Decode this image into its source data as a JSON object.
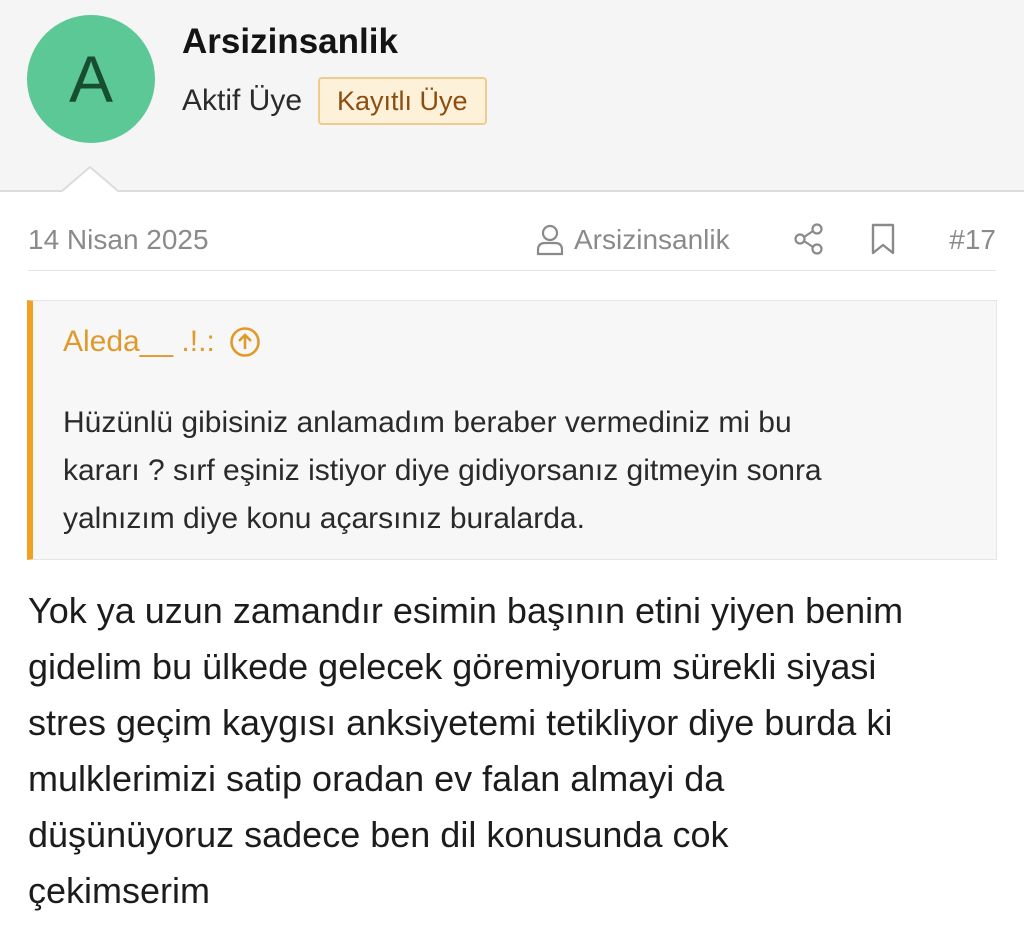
{
  "user": {
    "avatar_letter": "A",
    "avatar_color": "#5cc895",
    "name": "Arsizinsanlik",
    "title": "Aktif Üye",
    "badge": "Kayıtlı Üye"
  },
  "post": {
    "date": "14 Nisan 2025",
    "author": "Arsizinsanlik",
    "number": "#17",
    "icons": [
      "user-icon",
      "share-icon",
      "bookmark-icon"
    ],
    "quote": {
      "author": "Aleda__ .!.:",
      "author_icon": "arrow-up-circle-icon",
      "lines": [
        "Hüzünlü gibisiniz anlamadım beraber vermediniz mi bu",
        "kararı ? sırf eşiniz istiyor diye gidiyorsanız gitmeyin sonra",
        "yalnızım diye konu açarsınız buralarda."
      ]
    },
    "body_lines": [
      "Yok ya uzun zamandır esimin başının etini yiyen benim",
      "gidelim bu ülkede gelecek göremiyorum sürekli siyasi",
      "stres geçim kaygısı anksiyetemi tetikliyor diye burda ki",
      "mulklerimizi satip oradan ev falan almayi da",
      "düşünüyoruz sadece ben dil konusunda cok",
      "çekimserim"
    ]
  },
  "colors": {
    "accent_orange": "#f0a21f",
    "badge_bg": "#fdf1d9",
    "badge_border": "#f0cc8c",
    "badge_text": "#8c4e10"
  }
}
